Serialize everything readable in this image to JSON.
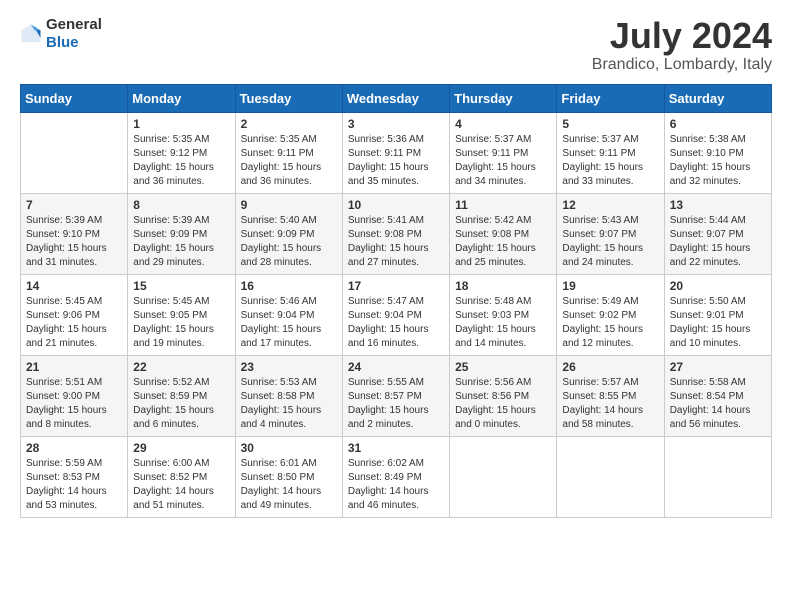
{
  "header": {
    "logo_line1": "General",
    "logo_line2": "Blue",
    "month": "July 2024",
    "location": "Brandico, Lombardy, Italy"
  },
  "weekdays": [
    "Sunday",
    "Monday",
    "Tuesday",
    "Wednesday",
    "Thursday",
    "Friday",
    "Saturday"
  ],
  "weeks": [
    [
      {
        "day": "",
        "sunrise": "",
        "sunset": "",
        "daylight": ""
      },
      {
        "day": "1",
        "sunrise": "5:35 AM",
        "sunset": "9:12 PM",
        "daylight": "15 hours and 36 minutes."
      },
      {
        "day": "2",
        "sunrise": "5:35 AM",
        "sunset": "9:11 PM",
        "daylight": "15 hours and 36 minutes."
      },
      {
        "day": "3",
        "sunrise": "5:36 AM",
        "sunset": "9:11 PM",
        "daylight": "15 hours and 35 minutes."
      },
      {
        "day": "4",
        "sunrise": "5:37 AM",
        "sunset": "9:11 PM",
        "daylight": "15 hours and 34 minutes."
      },
      {
        "day": "5",
        "sunrise": "5:37 AM",
        "sunset": "9:11 PM",
        "daylight": "15 hours and 33 minutes."
      },
      {
        "day": "6",
        "sunrise": "5:38 AM",
        "sunset": "9:10 PM",
        "daylight": "15 hours and 32 minutes."
      }
    ],
    [
      {
        "day": "7",
        "sunrise": "5:39 AM",
        "sunset": "9:10 PM",
        "daylight": "15 hours and 31 minutes."
      },
      {
        "day": "8",
        "sunrise": "5:39 AM",
        "sunset": "9:09 PM",
        "daylight": "15 hours and 29 minutes."
      },
      {
        "day": "9",
        "sunrise": "5:40 AM",
        "sunset": "9:09 PM",
        "daylight": "15 hours and 28 minutes."
      },
      {
        "day": "10",
        "sunrise": "5:41 AM",
        "sunset": "9:08 PM",
        "daylight": "15 hours and 27 minutes."
      },
      {
        "day": "11",
        "sunrise": "5:42 AM",
        "sunset": "9:08 PM",
        "daylight": "15 hours and 25 minutes."
      },
      {
        "day": "12",
        "sunrise": "5:43 AM",
        "sunset": "9:07 PM",
        "daylight": "15 hours and 24 minutes."
      },
      {
        "day": "13",
        "sunrise": "5:44 AM",
        "sunset": "9:07 PM",
        "daylight": "15 hours and 22 minutes."
      }
    ],
    [
      {
        "day": "14",
        "sunrise": "5:45 AM",
        "sunset": "9:06 PM",
        "daylight": "15 hours and 21 minutes."
      },
      {
        "day": "15",
        "sunrise": "5:45 AM",
        "sunset": "9:05 PM",
        "daylight": "15 hours and 19 minutes."
      },
      {
        "day": "16",
        "sunrise": "5:46 AM",
        "sunset": "9:04 PM",
        "daylight": "15 hours and 17 minutes."
      },
      {
        "day": "17",
        "sunrise": "5:47 AM",
        "sunset": "9:04 PM",
        "daylight": "15 hours and 16 minutes."
      },
      {
        "day": "18",
        "sunrise": "5:48 AM",
        "sunset": "9:03 PM",
        "daylight": "15 hours and 14 minutes."
      },
      {
        "day": "19",
        "sunrise": "5:49 AM",
        "sunset": "9:02 PM",
        "daylight": "15 hours and 12 minutes."
      },
      {
        "day": "20",
        "sunrise": "5:50 AM",
        "sunset": "9:01 PM",
        "daylight": "15 hours and 10 minutes."
      }
    ],
    [
      {
        "day": "21",
        "sunrise": "5:51 AM",
        "sunset": "9:00 PM",
        "daylight": "15 hours and 8 minutes."
      },
      {
        "day": "22",
        "sunrise": "5:52 AM",
        "sunset": "8:59 PM",
        "daylight": "15 hours and 6 minutes."
      },
      {
        "day": "23",
        "sunrise": "5:53 AM",
        "sunset": "8:58 PM",
        "daylight": "15 hours and 4 minutes."
      },
      {
        "day": "24",
        "sunrise": "5:55 AM",
        "sunset": "8:57 PM",
        "daylight": "15 hours and 2 minutes."
      },
      {
        "day": "25",
        "sunrise": "5:56 AM",
        "sunset": "8:56 PM",
        "daylight": "15 hours and 0 minutes."
      },
      {
        "day": "26",
        "sunrise": "5:57 AM",
        "sunset": "8:55 PM",
        "daylight": "14 hours and 58 minutes."
      },
      {
        "day": "27",
        "sunrise": "5:58 AM",
        "sunset": "8:54 PM",
        "daylight": "14 hours and 56 minutes."
      }
    ],
    [
      {
        "day": "28",
        "sunrise": "5:59 AM",
        "sunset": "8:53 PM",
        "daylight": "14 hours and 53 minutes."
      },
      {
        "day": "29",
        "sunrise": "6:00 AM",
        "sunset": "8:52 PM",
        "daylight": "14 hours and 51 minutes."
      },
      {
        "day": "30",
        "sunrise": "6:01 AM",
        "sunset": "8:50 PM",
        "daylight": "14 hours and 49 minutes."
      },
      {
        "day": "31",
        "sunrise": "6:02 AM",
        "sunset": "8:49 PM",
        "daylight": "14 hours and 46 minutes."
      },
      {
        "day": "",
        "sunrise": "",
        "sunset": "",
        "daylight": ""
      },
      {
        "day": "",
        "sunrise": "",
        "sunset": "",
        "daylight": ""
      },
      {
        "day": "",
        "sunrise": "",
        "sunset": "",
        "daylight": ""
      }
    ]
  ]
}
